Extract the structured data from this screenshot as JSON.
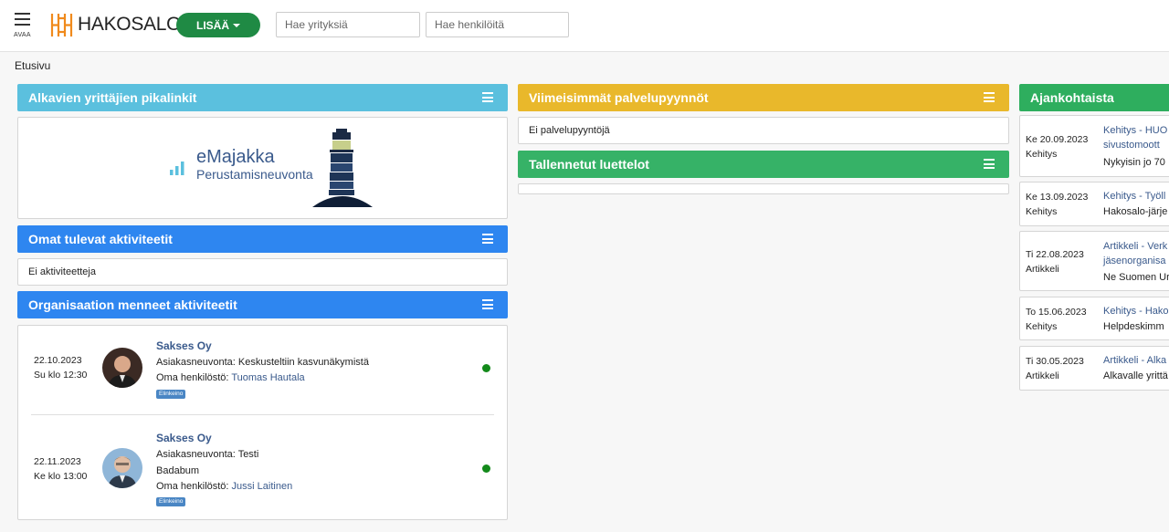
{
  "topbar": {
    "menu_label": "AVAA",
    "logo_text": "HAKOSALO",
    "add_button": "LISÄÄ",
    "search_company_placeholder": "Hae yrityksiä",
    "search_person_placeholder": "Hae henkilöitä"
  },
  "breadcrumb": "Etusivu",
  "colors": {
    "cyan": "#5bc0de",
    "blue": "#2e86f0",
    "yellow": "#e9b82b",
    "green": "#36b267",
    "brand_orange": "#f08a1c",
    "button_green": "#1f8a44"
  },
  "panels": {
    "quicklinks": {
      "title": "Alkavien yrittäjien pikalinkit",
      "emajakka_title": "eMajakka",
      "emajakka_subtitle": "Perustamisneuvonta"
    },
    "upcoming": {
      "title": "Omat tulevat aktiviteetit",
      "empty": "Ei aktiviteetteja"
    },
    "past": {
      "title": "Organisaation menneet aktiviteetit",
      "items": [
        {
          "date": "22.10.2023",
          "time": "Su klo 12:30",
          "company": "Sakses Oy",
          "lines": [
            "Asiakasneuvonta: Keskusteltiin kasvunäkymistä"
          ],
          "staff_label": "Oma henkilöstö:",
          "staff_name": "Tuomas Hautala",
          "tag": "Elinkeino"
        },
        {
          "date": "22.11.2023",
          "time": "Ke klo 13:00",
          "company": "Sakses Oy",
          "lines": [
            "Asiakasneuvonta: Testi",
            "Badabum"
          ],
          "staff_label": "Oma henkilöstö:",
          "staff_name": "Jussi Laitinen",
          "tag": "Elinkeino"
        }
      ]
    },
    "service_requests": {
      "title": "Viimeisimmät palvelupyynnöt",
      "empty": "Ei palvelupyyntöjä"
    },
    "saved_lists": {
      "title": "Tallennetut luettelot"
    },
    "news": {
      "title": "Ajankohtaista",
      "items": [
        {
          "date": "Ke 20.09.2023",
          "category": "Kehitys",
          "title_lines": [
            "Kehitys - HUO",
            "sivustomoott"
          ],
          "text": "Nykyisin jo 70"
        },
        {
          "date": "Ke 13.09.2023",
          "category": "Kehitys",
          "title_lines": [
            "Kehitys - Työll"
          ],
          "text": "Hakosalo-järje"
        },
        {
          "date": "Ti 22.08.2023",
          "category": "Artikkeli",
          "title_lines": [
            "Artikkeli - Verk",
            "jäsenorganisa"
          ],
          "text": "Ne Suomen Ur"
        },
        {
          "date": "To 15.06.2023",
          "category": "Kehitys",
          "title_lines": [
            "Kehitys - Hako"
          ],
          "text": "Helpdeskimm"
        },
        {
          "date": "Ti 30.05.2023",
          "category": "Artikkeli",
          "title_lines": [
            "Artikkeli - Alka"
          ],
          "text": "Alkavalle yrittä"
        }
      ]
    }
  }
}
